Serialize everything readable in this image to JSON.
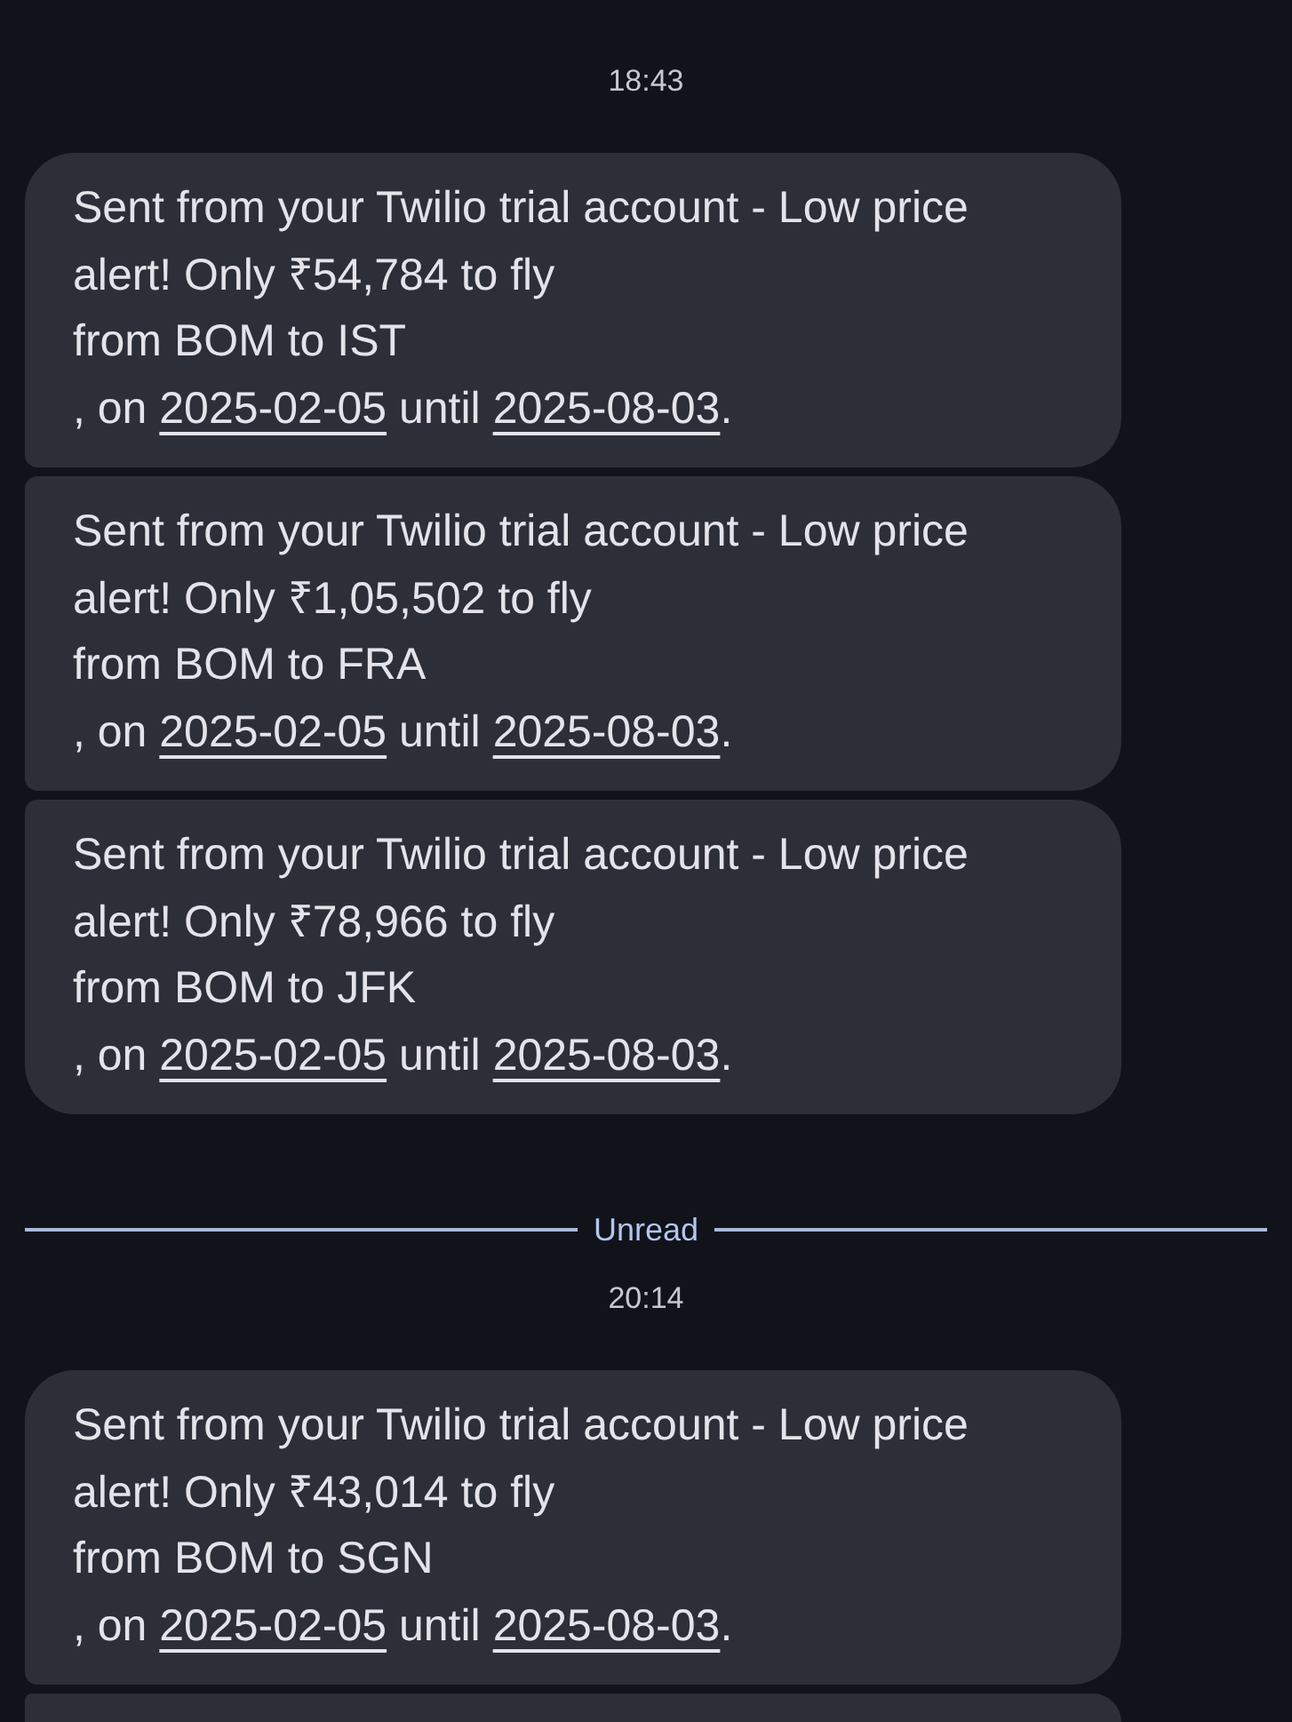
{
  "conversation": [
    {
      "kind": "timestamp",
      "text": "18:43"
    },
    {
      "kind": "messages",
      "messages": [
        {
          "kind": "full",
          "segments": [
            {
              "kind": "text",
              "text": "Sent from your Twilio trial account - Low price alert! Only ₹54,784 to fly\nfrom BOM to IST\n, on "
            },
            {
              "kind": "link",
              "text": "2025-02-05"
            },
            {
              "kind": "text",
              "text": " until "
            },
            {
              "kind": "link",
              "text": "2025-08-03"
            },
            {
              "kind": "text",
              "text": "."
            }
          ]
        },
        {
          "kind": "full",
          "segments": [
            {
              "kind": "text",
              "text": "Sent from your Twilio trial account - Low price alert! Only ₹1,05,502 to fly\nfrom BOM to FRA\n, on "
            },
            {
              "kind": "link",
              "text": "2025-02-05"
            },
            {
              "kind": "text",
              "text": " until "
            },
            {
              "kind": "link",
              "text": "2025-08-03"
            },
            {
              "kind": "text",
              "text": "."
            }
          ]
        },
        {
          "kind": "full",
          "segments": [
            {
              "kind": "text",
              "text": "Sent from your Twilio trial account - Low price alert! Only ₹78,966 to fly\nfrom BOM to JFK\n, on "
            },
            {
              "kind": "link",
              "text": "2025-02-05"
            },
            {
              "kind": "text",
              "text": " until "
            },
            {
              "kind": "link",
              "text": "2025-08-03"
            },
            {
              "kind": "text",
              "text": "."
            }
          ]
        }
      ]
    },
    {
      "kind": "unread_divider",
      "text": "Unread"
    },
    {
      "kind": "timestamp",
      "text": "20:14"
    },
    {
      "kind": "messages",
      "messages": [
        {
          "kind": "full",
          "segments": [
            {
              "kind": "text",
              "text": "Sent from your Twilio trial account - Low price alert! Only ₹43,014 to fly\nfrom BOM to SGN\n, on "
            },
            {
              "kind": "link",
              "text": "2025-02-05"
            },
            {
              "kind": "text",
              "text": " until "
            },
            {
              "kind": "link",
              "text": "2025-08-03"
            },
            {
              "kind": "text",
              "text": "."
            }
          ]
        },
        {
          "kind": "cut_off"
        }
      ]
    }
  ]
}
